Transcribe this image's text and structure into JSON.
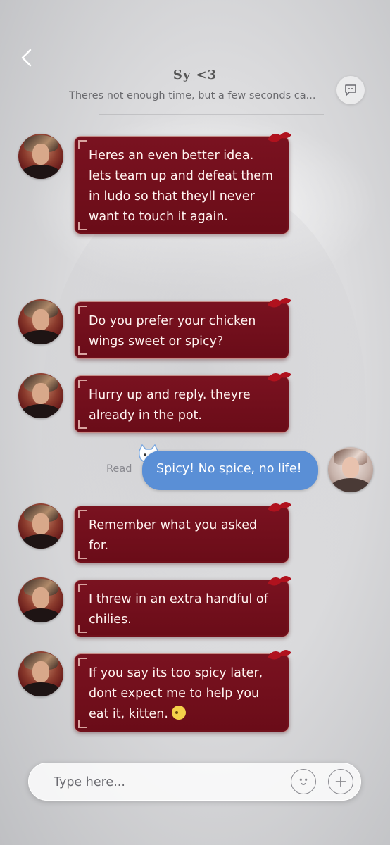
{
  "header": {
    "title": "Sy <3",
    "subtitle": "Theres not enough time, but a few seconds ca..."
  },
  "messages": [
    {
      "from": "Sy",
      "text": "Heres an even better idea. lets team up and defeat them in ludo so that theyll never want to touch it again."
    },
    {
      "from": "Sy",
      "text": "Do you prefer your chicken wings sweet or spicy?"
    },
    {
      "from": "Sy",
      "text": "Hurry up and reply. theyre already in the pot."
    },
    {
      "from": "me",
      "text": "Spicy! No spice, no life!",
      "status": "Read"
    },
    {
      "from": "Sy",
      "text": "Remember what you asked for."
    },
    {
      "from": "Sy",
      "text": "I threw in an extra handful of chilies."
    },
    {
      "from": "Sy",
      "text": "If you say its too spicy later, dont expect me to help you eat it, kitten."
    }
  ],
  "input": {
    "placeholder": "Type here..."
  },
  "icons": {
    "back": "chevron-left-icon",
    "more": "chat-options-icon",
    "emoji": "emoji-icon",
    "add": "plus-icon"
  },
  "colors": {
    "npc_bubble": "#6a0c18",
    "user_bubble": "#5a8fd6"
  }
}
